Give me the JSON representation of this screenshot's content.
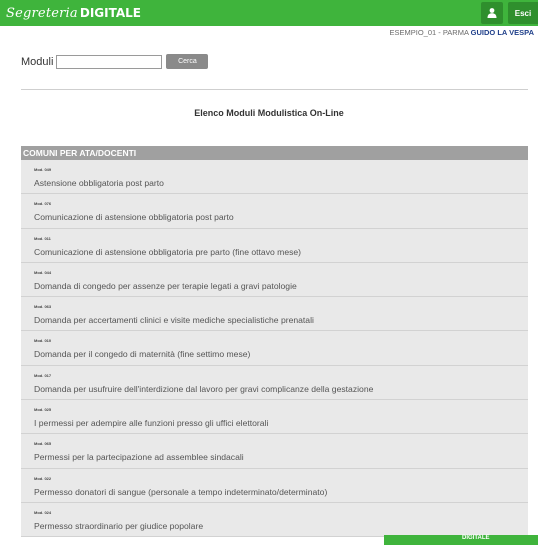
{
  "header": {
    "logo_script": "Segreteria",
    "logo_bold": "DIGITALE",
    "esci_label": "Esci",
    "icon_user": "user-icon"
  },
  "user": {
    "school": "ESEMPIO_01 - PARMA",
    "name": "GUIDO LA VESPA"
  },
  "search": {
    "label": "Moduli",
    "value": "",
    "placeholder": "",
    "button_label": "Cerca"
  },
  "list_title": "Elenco Moduli Modulistica On-Line",
  "section_title": "COMUNI PER ATA/DOCENTI",
  "items": [
    {
      "code": "Mod. 049",
      "title": "Astensione obbligatoria post parto"
    },
    {
      "code": "Mod. 076",
      "title": "Comunicazione di astensione obbligatoria post parto"
    },
    {
      "code": "Mod. 011",
      "title": "Comunicazione di astensione obbligatoria pre parto (fine ottavo mese)"
    },
    {
      "code": "Mod. 044",
      "title": "Domanda di congedo per assenze per terapie legati a gravi patologie"
    },
    {
      "code": "Mod. 063",
      "title": "Domanda per accertamenti clinici e visite mediche specialistiche prenatali"
    },
    {
      "code": "Mod. 010",
      "title": "Domanda per il congedo di maternità (fine settimo mese)"
    },
    {
      "code": "Mod. 017",
      "title": "Domanda per usufruire dell'interdizione dal lavoro per gravi complicanze della gestazione"
    },
    {
      "code": "Mod. 025",
      "title": "I permessi per adempire alle funzioni presso gli uffici elettorali"
    },
    {
      "code": "Mod. 065",
      "title": "Permessi per la partecipazione ad assemblee sindacali"
    },
    {
      "code": "Mod. 022",
      "title": "Permesso donatori di sangue (personale a tempo indeterminato/determinato)"
    },
    {
      "code": "Mod. 024",
      "title": "Permesso straordinario per giudice popolare"
    }
  ],
  "float_panel": {
    "logo_bold": "DIGITALE"
  },
  "colors": {
    "header_green": "#3fb43c",
    "button_dark_green": "#2f8f2d",
    "section_gray": "#a0a0a0",
    "item_bg": "#e9e9e9",
    "user_name_blue": "#1f3f8a"
  }
}
